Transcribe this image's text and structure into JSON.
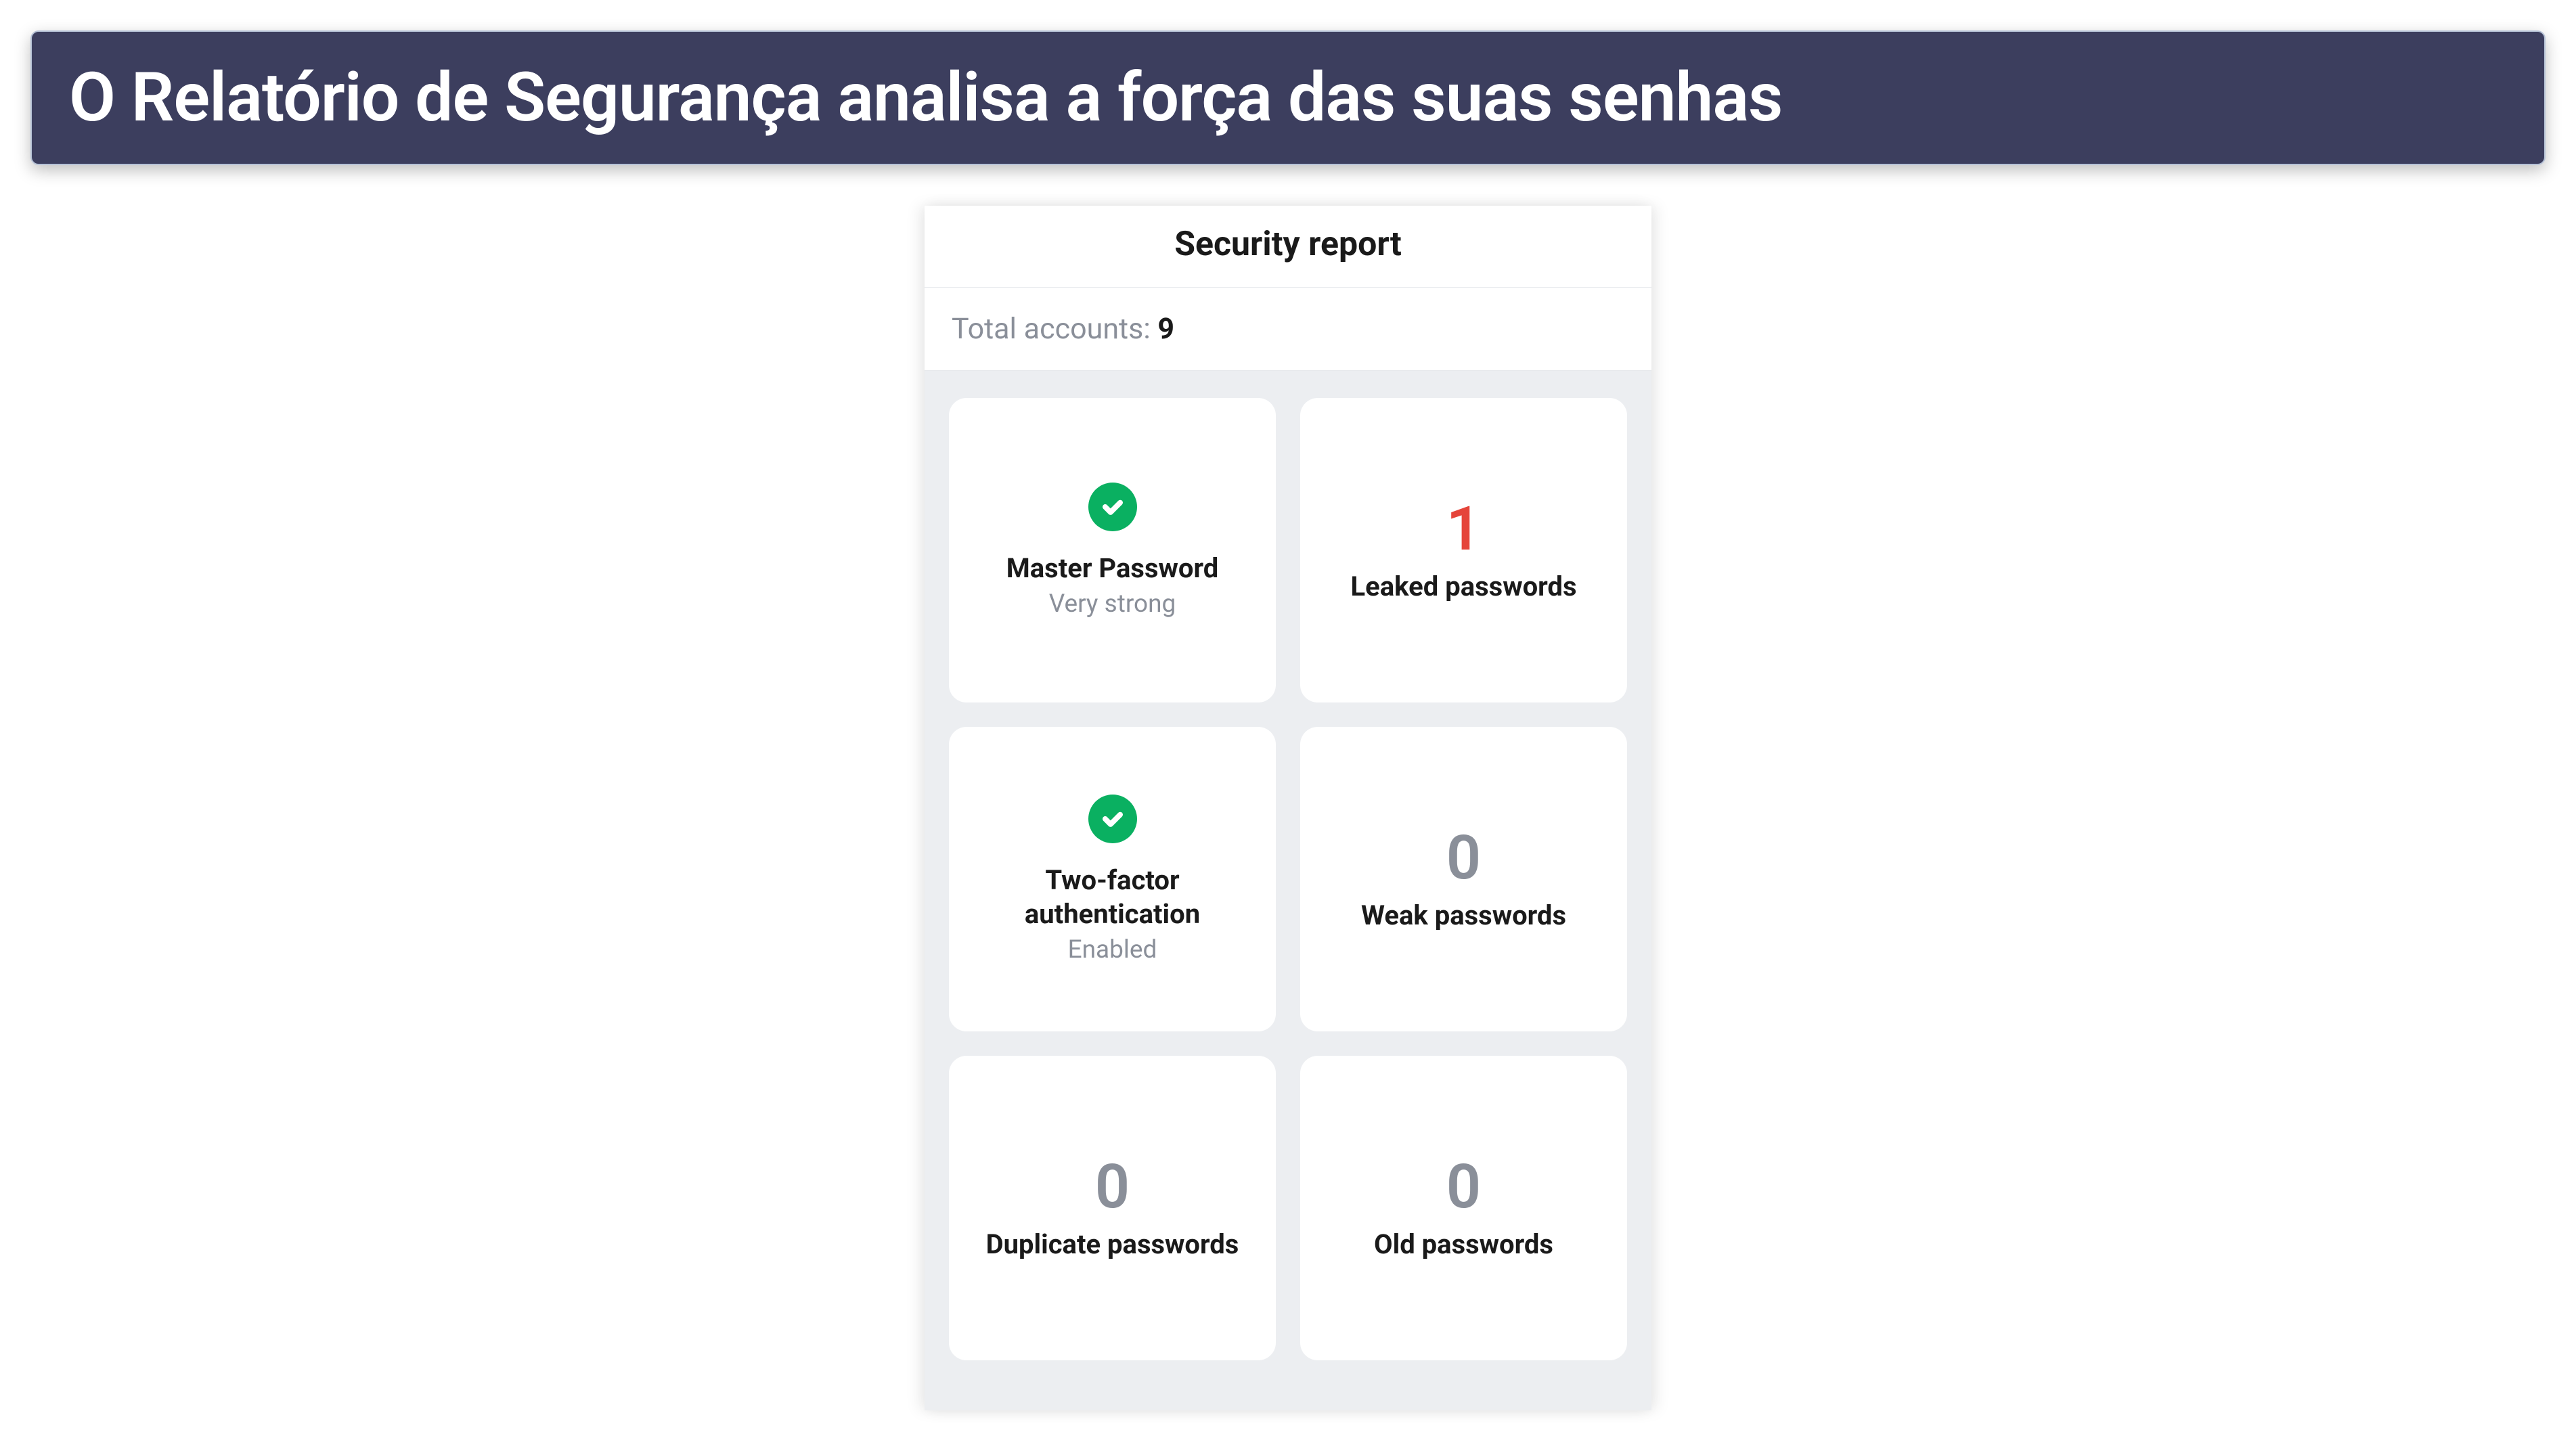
{
  "banner": {
    "text": "O Relatório de Segurança analisa a força das suas senhas"
  },
  "report": {
    "title": "Security report",
    "total_label": "Total accounts: ",
    "total_count": "9",
    "cards": {
      "master_password": {
        "icon": "check-circle-icon",
        "title": "Master Password",
        "subtitle": "Very strong"
      },
      "leaked": {
        "value": "1",
        "color": "red",
        "label": "Leaked passwords"
      },
      "two_factor": {
        "icon": "check-circle-icon",
        "title": "Two-factor authentication",
        "subtitle": "Enabled"
      },
      "weak": {
        "value": "0",
        "color": "gray",
        "label": "Weak passwords"
      },
      "duplicate": {
        "value": "0",
        "color": "gray",
        "label": "Duplicate passwords"
      },
      "old": {
        "value": "0",
        "color": "gray",
        "label": "Old passwords"
      }
    }
  }
}
